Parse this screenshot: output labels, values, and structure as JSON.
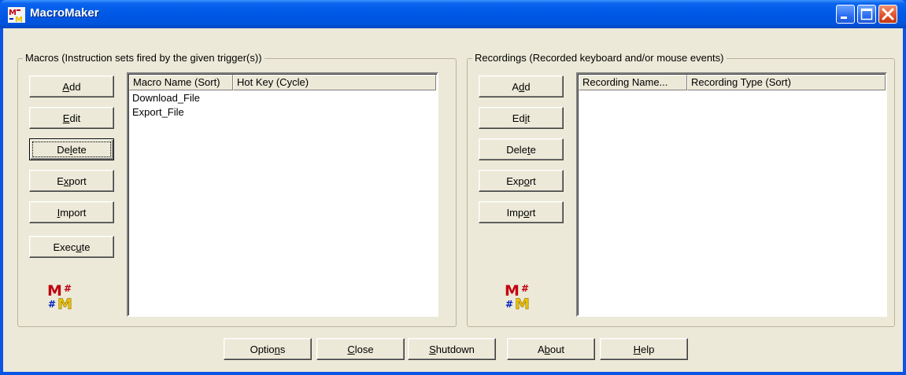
{
  "window": {
    "title": "MacroMaker",
    "colors": {
      "titlebar": "#0058e6",
      "client": "#ece9d8",
      "close_button": "#e0502a"
    }
  },
  "title_controls": [
    {
      "name": "minimize-icon"
    },
    {
      "name": "maximize-icon"
    },
    {
      "name": "close-icon"
    }
  ],
  "macros": {
    "group_label": "Macros (Instruction sets fired by the given trigger(s))",
    "buttons": [
      {
        "id": "add",
        "pre": "",
        "key": "A",
        "post": "dd"
      },
      {
        "id": "edit",
        "pre": "",
        "key": "E",
        "post": "dit"
      },
      {
        "id": "delete",
        "pre": "De",
        "key": "l",
        "post": "ete"
      },
      {
        "id": "export",
        "pre": "E",
        "key": "x",
        "post": "port"
      },
      {
        "id": "import",
        "pre": "",
        "key": "I",
        "post": "mport"
      },
      {
        "id": "execute",
        "pre": "Exec",
        "key": "u",
        "post": "te"
      }
    ],
    "columns": [
      "Macro Name (Sort)",
      "Hot Key (Cycle)"
    ],
    "rows": [
      "Download_File",
      "Export_File"
    ]
  },
  "recordings": {
    "group_label": "Recordings (Recorded keyboard and/or mouse events)",
    "buttons": [
      {
        "id": "add",
        "pre": "A",
        "key": "d",
        "post": "d"
      },
      {
        "id": "edit",
        "pre": "Ed",
        "key": "i",
        "post": "t"
      },
      {
        "id": "delete",
        "pre": "Dele",
        "key": "t",
        "post": "e"
      },
      {
        "id": "export",
        "pre": "Exp",
        "key": "o",
        "post": "rt"
      },
      {
        "id": "import",
        "pre": "Imp",
        "key": "o",
        "post": "rt"
      }
    ],
    "columns": [
      "Recording Name...",
      "Recording Type (Sort)"
    ],
    "rows": []
  },
  "bottom_buttons": [
    {
      "id": "options",
      "pre": "Optio",
      "key": "n",
      "post": "s"
    },
    {
      "id": "close",
      "pre": "",
      "key": "C",
      "post": "lose"
    },
    {
      "id": "shutdown",
      "pre": "",
      "key": "S",
      "post": "hutdown"
    },
    {
      "id": "about",
      "pre": "A",
      "key": "b",
      "post": "out"
    },
    {
      "id": "help",
      "pre": "",
      "key": "H",
      "post": "elp"
    }
  ]
}
